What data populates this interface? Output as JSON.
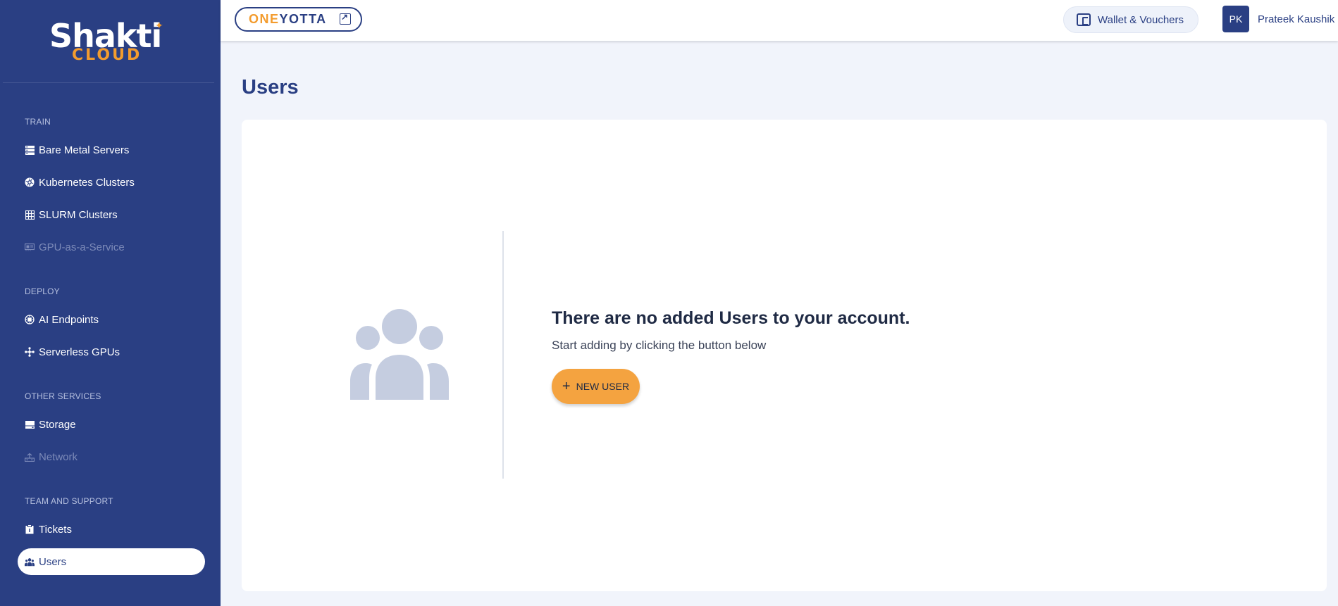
{
  "brand": {
    "logo_word": "Shakti",
    "logo_sub": "CLOUD"
  },
  "sidebar": {
    "sections": [
      {
        "label": "TRAIN",
        "items": [
          {
            "label": "Bare Metal Servers",
            "icon": "server-rack-icon",
            "disabled": false
          },
          {
            "label": "Kubernetes Clusters",
            "icon": "kubernetes-icon",
            "disabled": false
          },
          {
            "label": "SLURM Clusters",
            "icon": "grid-icon",
            "disabled": false
          },
          {
            "label": "GPU-as-a-Service",
            "icon": "gpu-card-icon",
            "disabled": true
          }
        ]
      },
      {
        "label": "DEPLOY",
        "items": [
          {
            "label": "AI Endpoints",
            "icon": "chip-icon",
            "disabled": false
          },
          {
            "label": "Serverless GPUs",
            "icon": "nodes-icon",
            "disabled": false
          }
        ]
      },
      {
        "label": "OTHER SERVICES",
        "items": [
          {
            "label": "Storage",
            "icon": "storage-icon",
            "disabled": false
          },
          {
            "label": "Network",
            "icon": "network-icon",
            "disabled": true
          }
        ]
      },
      {
        "label": "TEAM AND SUPPORT",
        "items": [
          {
            "label": "Tickets",
            "icon": "ticket-icon",
            "disabled": false
          },
          {
            "label": "Users",
            "icon": "users-icon",
            "disabled": false,
            "active": true
          }
        ]
      }
    ]
  },
  "topbar": {
    "oneyotta_one": "ONE",
    "oneyotta_yotta": "YOTTA",
    "wallet_label": "Wallet & Vouchers",
    "avatar_initials": "PK",
    "user_name": "Prateek Kaushik"
  },
  "main": {
    "title": "Users",
    "empty_title": "There are no added Users to your account.",
    "empty_subtitle": "Start adding by clicking the button below",
    "new_user_label": "NEW USER"
  },
  "colors": {
    "sidebar_bg": "#2a3f83",
    "accent_orange": "#f39c2e",
    "button_orange": "#f4a340",
    "page_bg": "#f1f4fb"
  }
}
